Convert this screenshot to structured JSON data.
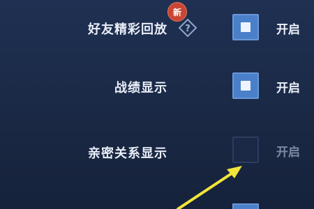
{
  "settings": [
    {
      "label": "好友精彩回放",
      "enabled": true,
      "state_label": "开启",
      "badge": "新",
      "help_icon": "question-diamond-icon"
    },
    {
      "label": "战绩显示",
      "enabled": true,
      "state_label": "开启"
    },
    {
      "label": "亲密关系显示",
      "enabled": false,
      "state_label": "开启"
    }
  ],
  "colors": {
    "checkbox_on": "#4a7fc9",
    "checkbox_off": "#1b2946",
    "badge": "#c94534",
    "annotation_arrow": "#f3e53a"
  }
}
